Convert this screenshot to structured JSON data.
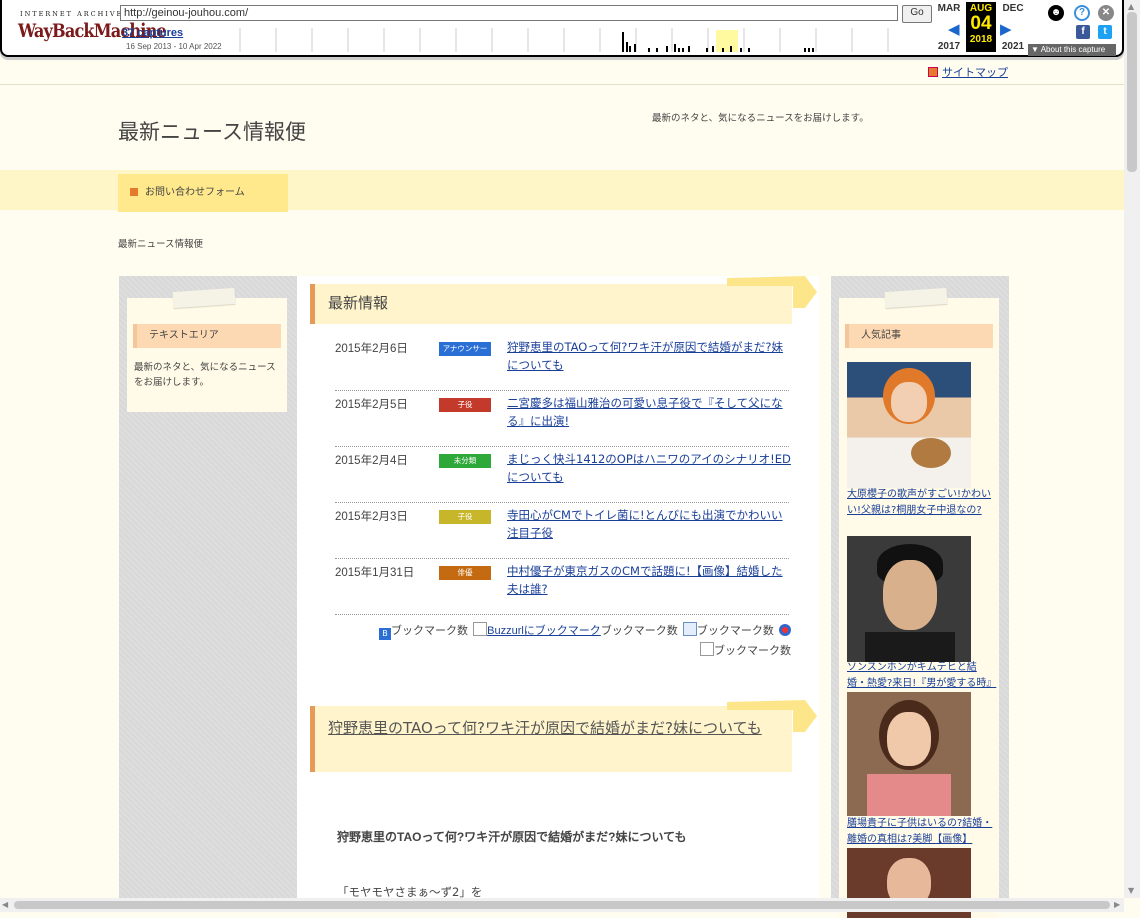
{
  "wayback": {
    "logo_top": "INTERNET ARCHIVE",
    "logo_main": "WayBackMachine",
    "url": "http://geinou-jouhou.com/",
    "go_label": "Go",
    "captures": "37 captures",
    "range": "16 Sep 2013 - 10 Apr 2022",
    "prev_month": "MAR",
    "cur_month": "AUG",
    "next_month": "DEC",
    "cur_day": "04",
    "prev_year": "2017",
    "cur_year": "2018",
    "next_year": "2021",
    "about": "About this capture"
  },
  "site": {
    "sitemap": "サイトマップ",
    "title": "最新ニュース情報便",
    "tagline": "最新のネタと、気になるニュースをお届けします。",
    "nav_contact": "お問い合わせフォーム",
    "breadcrumb": "最新ニュース情報便"
  },
  "left_widget": {
    "title": "テキストエリア",
    "text": "最新のネタと、気になるニュースをお届けします。"
  },
  "main": {
    "news_heading": "最新情報",
    "news": [
      {
        "date": "2015年2月6日",
        "cat": "アナウンサー",
        "cat_color": "#2a6fd6",
        "title": "狩野恵里のTAOって何?ワキ汗が原因で結婚がまだ?妹についても"
      },
      {
        "date": "2015年2月5日",
        "cat": "子役",
        "cat_color": "#c43a2a",
        "title": "二宮慶多は福山雅治の可愛い息子役で『そして父になる』に出演!"
      },
      {
        "date": "2015年2月4日",
        "cat": "未分類",
        "cat_color": "#2fa83a",
        "title": "まじっく快斗1412のOPはハニワのアイのシナリオ!EDについても"
      },
      {
        "date": "2015年2月3日",
        "cat": "子役",
        "cat_color": "#c8b62a",
        "title": "寺田心がCMでトイレ菌に!とんびにも出演でかわいい注目子役"
      },
      {
        "date": "2015年1月31日",
        "cat": "俳優",
        "cat_color": "#c46a10",
        "title": "中村優子が東京ガスのCMで話題に!【画像】結婚した夫は誰?"
      }
    ],
    "bookmarks": {
      "hatena_alt": "ブックマーク数",
      "buzzurl": "Buzzurlにブックマーク",
      "alt2": "ブックマーク数",
      "alt3": "ブックマーク数",
      "alt4": "ブックマーク数"
    },
    "article_title": "狩野恵里のTAOって何?ワキ汗が原因で結婚がまだ?妹についても",
    "article_subtitle": "狩野恵里のTAOって何?ワキ汗が原因で結婚がまだ?妹についても",
    "article_text": "「モヤモヤさまぁ〜ず2」を"
  },
  "right_widget": {
    "title": "人気記事",
    "items": [
      {
        "title": "大原櫻子の歌声がすごい!かわいい!父親は?桐朋女子中退なの?"
      },
      {
        "title": "ソンスンホンがキムテヒと結婚・熱愛?来日!『男が愛する時』"
      },
      {
        "title": "膳場貴子に子供はいるの?結婚・離婚の真相は?美脚【画像】"
      }
    ]
  }
}
